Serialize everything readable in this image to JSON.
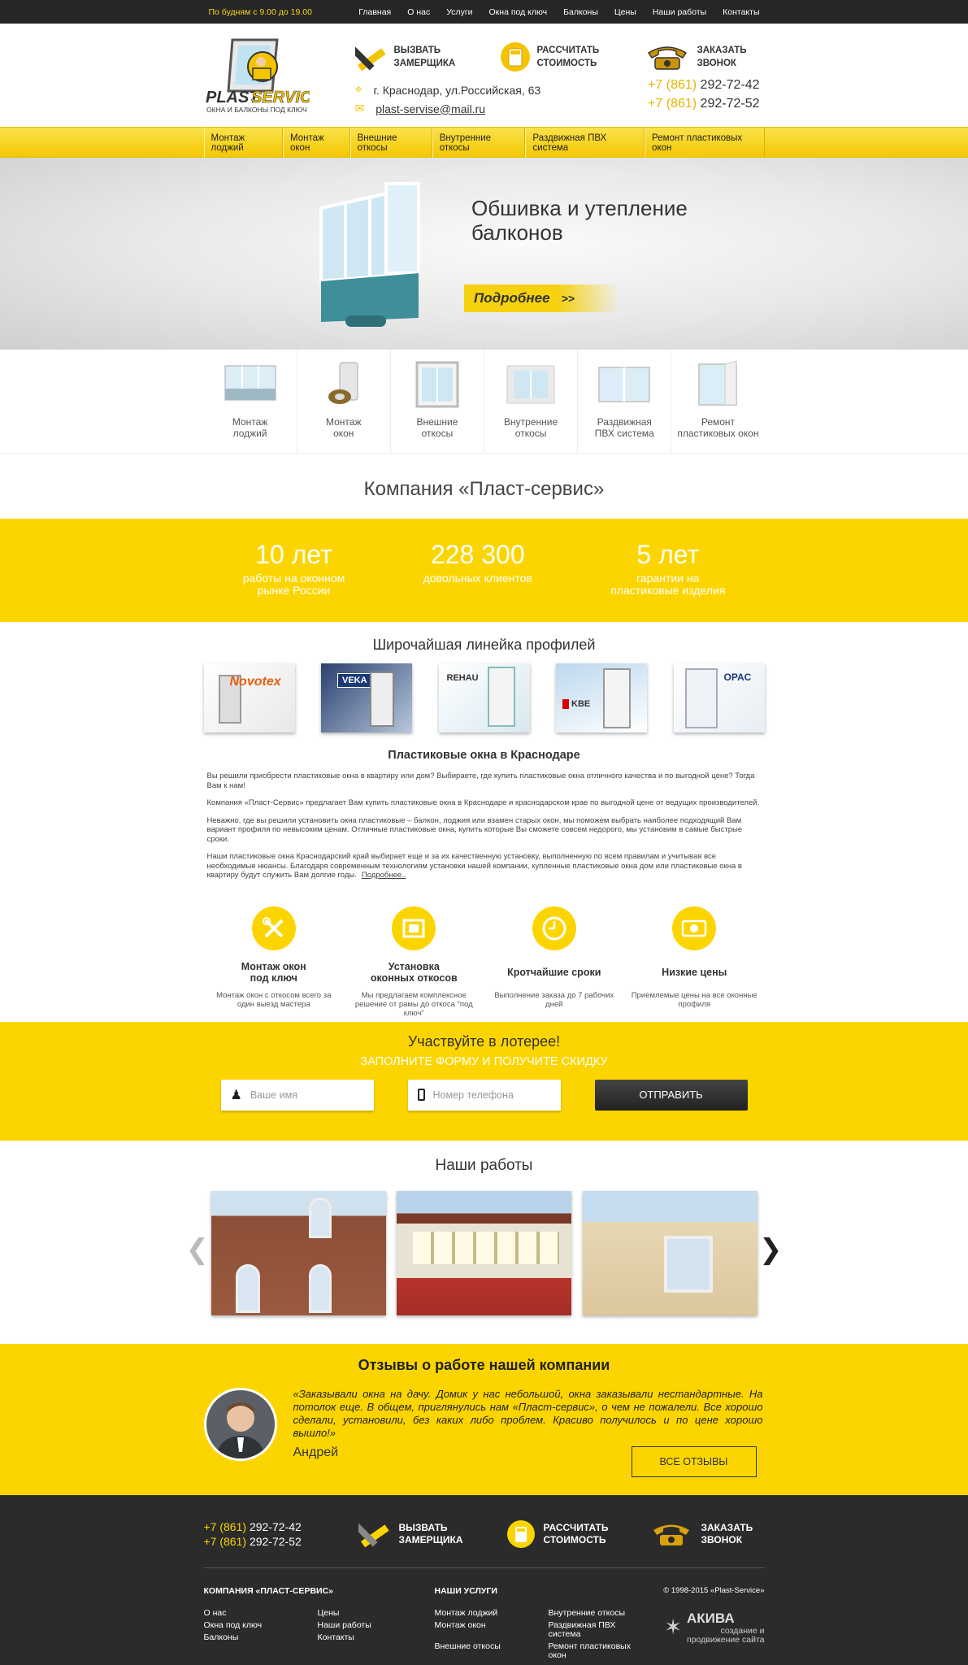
{
  "topbar": {
    "hours": "По будням с 9.00 до 19.00",
    "nav": [
      "Главная",
      "О нас",
      "Услуги",
      "Окна под ключ",
      "Балконы",
      "Цены",
      "Наши работы",
      "Контакты"
    ]
  },
  "header": {
    "logo_line1": "PLAST",
    "logo_line2": "SERVICE",
    "logo_tagline": "ОКНА И БАЛКОНЫ ПОД КЛЮЧ",
    "actions": [
      {
        "line1": "ВЫЗВАТЬ",
        "line2": "ЗАМЕРЩИКА",
        "icon": "ruler-pencil-icon"
      },
      {
        "line1": "РАССЧИТАТЬ",
        "line2": "СТОИМОСТЬ",
        "icon": "calculator-icon"
      },
      {
        "line1": "ЗАКАЗАТЬ",
        "line2": "ЗВОНОК",
        "icon": "phone-icon"
      }
    ],
    "address": "г. Краснодар, ул.Российская, 63",
    "email": "plast-servise@mail.ru",
    "phones": [
      {
        "code": "+7 (861)",
        "number": "292-72-42"
      },
      {
        "code": "+7 (861)",
        "number": "292-72-52"
      }
    ]
  },
  "menu": [
    "Монтаж лоджий",
    "Монтаж окон",
    "Внешние откосы",
    "Внутренние откосы",
    "Раздвижная ПВХ система",
    "Ремонт пластиковых окон"
  ],
  "hero": {
    "title": "Обшивка и утепление балконов",
    "button": "Подробнее"
  },
  "services": [
    {
      "line1": "Монтаж",
      "line2": "лоджий"
    },
    {
      "line1": "Монтаж",
      "line2": "окон"
    },
    {
      "line1": "Внешние",
      "line2": "откосы"
    },
    {
      "line1": "Внутренние",
      "line2": "откосы"
    },
    {
      "line1": "Раздвижная",
      "line2": "ПВХ система"
    },
    {
      "line1": "Ремонт",
      "line2": "пластиковых окон"
    }
  ],
  "company": {
    "title": "Компания «Пласт-сервис»",
    "stats": [
      {
        "num": "10 лет",
        "line1": "работы на оконном",
        "line2": "рынке России"
      },
      {
        "num": "228 300",
        "line1": "довольных клиентов",
        "line2": ""
      },
      {
        "num": "5 лет",
        "line1": "гарантии на",
        "line2": "пластиковые изделия"
      }
    ]
  },
  "profiles": {
    "title": "Широчайшая линейка профилей",
    "brands": [
      "Novotex",
      "VEKA",
      "REHAU",
      "KBE",
      "OPAC"
    ]
  },
  "seo": {
    "title": "Пластиковые окна в Краснодаре",
    "p1": "Вы решили приобрести пластиковые окна в квартиру или дом? Выбираете, где купить пластиковые окна отличного качества и по выгодной цене? Тогда Вам к нам!",
    "p2": "Компания «Пласт-Сервис» предлагает Вам купить пластиковые окна в Краснодаре и краснодарском крае по выгодной цене от ведущих производителей.",
    "p3": "Неважно, где вы решили установить окна пластиковые – балкон, лоджия или взамен старых окон, мы поможем выбрать наиболее подходящий Вам вариант профиля по невысоким ценам. Отличные пластиковые окна, купить которые Вы сможете совсем недорого, мы установим в самые быстрые сроки.",
    "p4": "Наши пластиковые окна Краснодарский край выбирает еще и за их качественную установку, выполненную по всем правилам и учитывая все необходимые нюансы. Благодаря современным технологиям установки нашей компании, купленные пластиковые окна дом или пластиковые окна в квартиру будут служить Вам долгие годы.",
    "more": "Подробнее.."
  },
  "features": [
    {
      "title1": "Монтаж окон",
      "title2": "под ключ",
      "desc": "Монтаж окон с откосом всего за один выезд мастера",
      "icon": "wrench-screwdriver-icon"
    },
    {
      "title1": "Установка",
      "title2": "оконных откосов",
      "desc": "Мы предлагаем комплексное решение от рамы до откоса \"под ключ\"",
      "icon": "window-frame-icon"
    },
    {
      "title1": "Кротчайшие сроки",
      "title2": "",
      "desc": "Выполнение заказа до 7 рабочих дней",
      "icon": "clock-icon"
    },
    {
      "title1": "Низкие цены",
      "title2": "",
      "desc": "Приемлемые цены на все оконные профиля",
      "icon": "money-icon"
    }
  ],
  "lottery": {
    "title": "Участвуйте в лотерее!",
    "subtitle": "ЗАПОЛНИТЕ ФОРМУ И ПОЛУЧИТЕ СКИДКУ",
    "name_placeholder": "Ваше имя",
    "phone_placeholder": "Номер телефона",
    "submit": "ОТПРАВИТЬ"
  },
  "works": {
    "title": "Наши работы",
    "prev": "❮",
    "next": "❯"
  },
  "reviews": {
    "title": "Отзывы о работе нашей компании",
    "text": "«Заказывали окна на дачу. Домик у нас небольшой, окна заказывали нестандартные. На потолок еще. В общем, приглянулись нам «Пласт-сервис», о чем не пожалели. Все хорошо сделали, установили, без каких либо проблем. Красиво получилось и по цене хорошо вышло!»",
    "author": "Андрей",
    "button": "ВСЕ ОТЗЫВЫ"
  },
  "footer": {
    "phones": [
      {
        "code": "+7 (861)",
        "number": "292-72-42"
      },
      {
        "code": "+7 (861)",
        "number": "292-72-52"
      }
    ],
    "actions": [
      {
        "line1": "ВЫЗВАТЬ",
        "line2": "ЗАМЕРЩИКА"
      },
      {
        "line1": "РАССЧИТАТЬ",
        "line2": "СТОИМОСТЬ"
      },
      {
        "line1": "ЗАКАЗАТЬ",
        "line2": "ЗВОНОК"
      }
    ],
    "company_title": "КОМПАНИЯ «ПЛАСТ-СЕРВИС»",
    "company_links": [
      "О нас",
      "Цены",
      "Окна под ключ",
      "Наши работы",
      "Балконы",
      "Контакты"
    ],
    "services_title": "НАШИ УСЛУГИ",
    "services_links": [
      "Монтаж лоджий",
      "Внутренние откосы",
      "Монтаж окон",
      "Раздвижная ПВХ система",
      "Внешние откосы",
      "Ремонт пластиковых окон"
    ],
    "copyright": "© 1998-2015 «Plast-Service»",
    "dev_name": "АКИВА",
    "dev_line1": "создание и",
    "dev_line2": "продвижение сайта"
  },
  "colors": {
    "accent": "#fcd500",
    "dark": "#262626"
  }
}
